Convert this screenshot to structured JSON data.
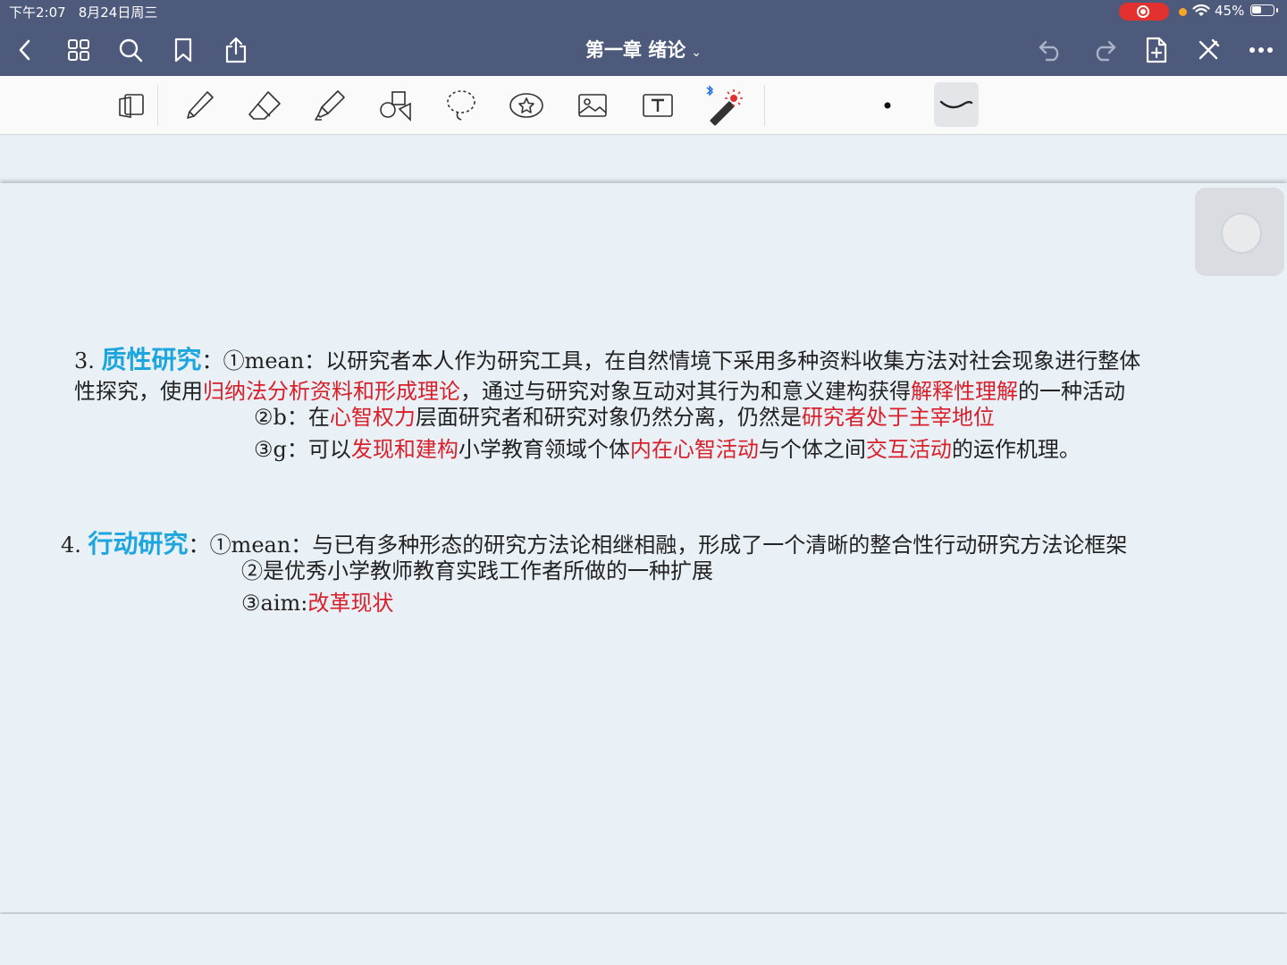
{
  "status_bar": {
    "time": "下午2:07",
    "date": "8月24日周三",
    "battery": "45%"
  },
  "nav": {
    "title": "第一章 绪论",
    "chevron": "⌄",
    "icons": [
      "back-icon",
      "grid-icon",
      "search-icon",
      "bookmark-icon",
      "share-icon",
      "undo-icon",
      "redo-icon",
      "add-page-icon",
      "close-pen-icon",
      "more-icon"
    ]
  },
  "tools": [
    "flip-page-icon",
    "pen-icon",
    "eraser-icon",
    "highlighter-icon",
    "shapes-icon",
    "lasso-icon",
    "sticker-icon",
    "image-icon",
    "text-box-icon",
    "laser-pointer-icon",
    "dot-size-icon",
    "stroke-style-icon"
  ],
  "colors": {
    "nav_bg": "#4d5a7c",
    "page_bg": "#e9f0f6",
    "heading_blue": "#1ca6dd",
    "highlight_red": "#d9202a",
    "record_red": "#e2312f"
  },
  "note": {
    "s3": {
      "num": "3.",
      "heading": "质性研究",
      "colon": "：",
      "l1_rest": "①mean：以研究者本人作为研究工具，在自然情境下采用多种资料收集方法对社会现象进行整体",
      "l2_a": "性探究，使用",
      "l2_red1": "归纳法分析资料和形成理论",
      "l2_b": "，通过与研究对象互动对其行为和意义建构获得",
      "l2_red2": "解释性理解",
      "l2_c": "的一种活动",
      "l3_a": "②b：在",
      "l3_red1": "心智权力",
      "l3_b": "层面研究者和研究对象仍然分离，仍然是",
      "l3_red2": "研究者处于主宰地位",
      "l4_a": "③g：可以",
      "l4_red1": "发现和建构",
      "l4_b": "小学教育领域个体",
      "l4_red2": "内在心智活动",
      "l4_c": "与个体之间",
      "l4_red3": "交互活动",
      "l4_d": "的运作机理。"
    },
    "s4": {
      "num": "4.",
      "heading": "行动研究",
      "colon": "：",
      "l1_rest": "①mean：与已有多种形态的研究方法论相继相融，形成了一个清晰的整合性行动研究方法论框架",
      "l2": "②是优秀小学教师教育实践工作者所做的一种扩展",
      "l3_a": "③aim:",
      "l3_red": "改革现状"
    }
  }
}
